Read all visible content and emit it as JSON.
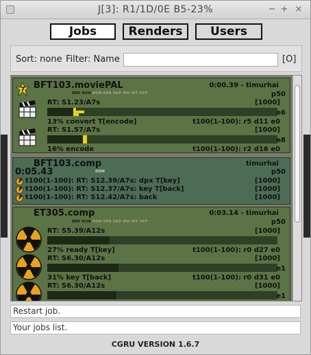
{
  "window": {
    "title": "J[3]: R1/1D/0E B5-23%",
    "min": "−",
    "max": "+",
    "close": "×"
  },
  "tabs": [
    {
      "label": "Jobs"
    },
    {
      "label": "Renders"
    },
    {
      "label": "Users"
    }
  ],
  "filter": {
    "sort_label": "Sort: none",
    "filter_label": "Filter: Name",
    "value": "",
    "toggle_label": "[O]"
  },
  "jobs": [
    {
      "name": "BFT103.moviePAL",
      "time_user": "0:00.39 - timurhai",
      "priority": "p50",
      "badge": "7",
      "states": [
        "RDY",
        "RUN",
        "DON",
        "ERR",
        "SKP",
        "WD",
        "WT",
        "OFF"
      ],
      "blocks": [
        {
          "rt": "RT: S1.23/A7s",
          "frames": "[1000]",
          "e": "e6",
          "info_left": "13% convert T[encode]",
          "info_right": "t100(1-100): r5 d11 e0",
          "percent": 13
        },
        {
          "rt": "RT: S1.57/A7s",
          "frames": "[1000]",
          "e": "e8",
          "info_left": "16% encode",
          "info_right": "t100(1-100): r2 d16 e0",
          "percent": 16
        }
      ]
    },
    {
      "name": "BFT103.comp",
      "user": "timurhai",
      "elapsed": "0:05.43",
      "priority": "p50",
      "states": [
        "DON"
      ],
      "tasks": [
        {
          "text": "t100(1-100): RT: S12.39/A7s: dpx T[key]",
          "frames": "[1000]"
        },
        {
          "text": "t100(1-100): RT: S12.37/A7s: key T[back]",
          "frames": "[1000]"
        },
        {
          "text": "t100(1-100): RT: S12.42/A7s: back",
          "frames": "[1000]"
        }
      ]
    },
    {
      "name": "ET305.comp",
      "time_user": "0:03.14 - timurhai",
      "priority": "p50",
      "states": [
        "RDY",
        "RUN",
        "DON",
        "ERR",
        "SKP",
        "WD",
        "WT",
        "OFF"
      ],
      "blocks": [
        {
          "rt": "RT: S5.39/A12s",
          "frames": "[1000]",
          "e": "",
          "info_left": "27% ready T[key]",
          "info_right": "t100(1-100): r0 d27 e0",
          "percent": 27
        },
        {
          "rt": "RT: S6.30/A12s",
          "frames": "[1000]",
          "e": "e1",
          "info_left": "31% key T[back]",
          "info_right": "t100(1-100): r0 d31 e0",
          "percent": 31
        },
        {
          "rt": "RT: S6.30/A12s",
          "frames": "[1000]",
          "e": "e1",
          "info_left": "",
          "info_right": "",
          "percent": 0
        }
      ]
    }
  ],
  "status": {
    "line1": "Restart job.",
    "line2": "Your jobs list."
  },
  "footer": "CGRU VERSION 1.6.7",
  "colors": {
    "job_green": "#5b7345",
    "job_teal": "#4c6c56",
    "yellow": "#e6d219",
    "state_colors": {
      "RDY": "#151515",
      "RUN": "#1f1f1f",
      "DON": "#c8d8c8",
      "ERR": "#a4a08a",
      "SKP": "#a4a08a",
      "WD": "#a4a08a",
      "WT": "#a4a08a",
      "OFF": "#a4a08a"
    }
  }
}
